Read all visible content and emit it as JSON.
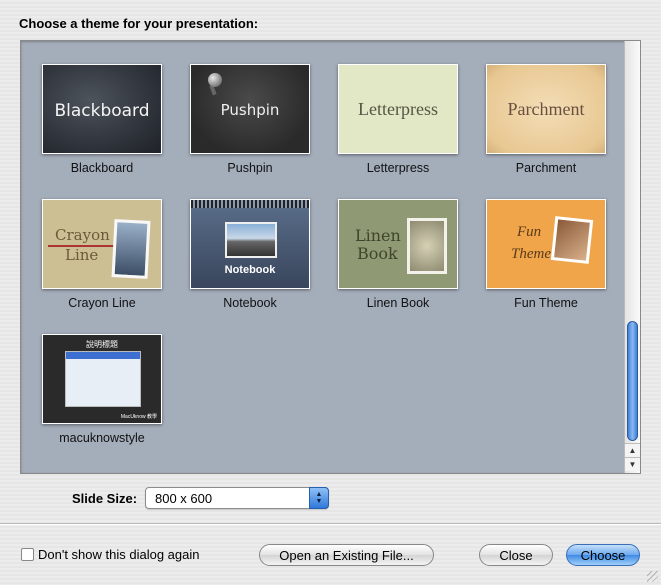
{
  "dialog": {
    "heading": "Choose a theme for your presentation:"
  },
  "themes": [
    {
      "label": "Blackboard",
      "thumb_title": "Blackboard"
    },
    {
      "label": "Pushpin",
      "thumb_title": "Pushpin"
    },
    {
      "label": "Letterpress",
      "thumb_title": "Letterpress"
    },
    {
      "label": "Parchment",
      "thumb_title": "Parchment"
    },
    {
      "label": "Crayon Line",
      "thumb_title_1": "Crayon",
      "thumb_title_2": "Line"
    },
    {
      "label": "Notebook",
      "thumb_title": "Notebook"
    },
    {
      "label": "Linen Book",
      "thumb_title_1": "Linen",
      "thumb_title_2": "Book"
    },
    {
      "label": "Fun Theme",
      "thumb_title_1": "Fun",
      "thumb_title_2": "Theme"
    },
    {
      "label": "macuknowstyle",
      "thumb_title": "說明標題",
      "thumb_badge": "MacUknow 教學"
    }
  ],
  "slide_size": {
    "label": "Slide Size:",
    "value": "800 x 600"
  },
  "footer": {
    "checkbox_label": "Don't show this dialog again",
    "checkbox_checked": false,
    "open_button": "Open an Existing File...",
    "close_button": "Close",
    "choose_button": "Choose"
  },
  "scrollbar": {
    "position_fraction": 1.0
  },
  "colors": {
    "browser_bg": "#a4adba",
    "accent": "#3f8ae4"
  }
}
